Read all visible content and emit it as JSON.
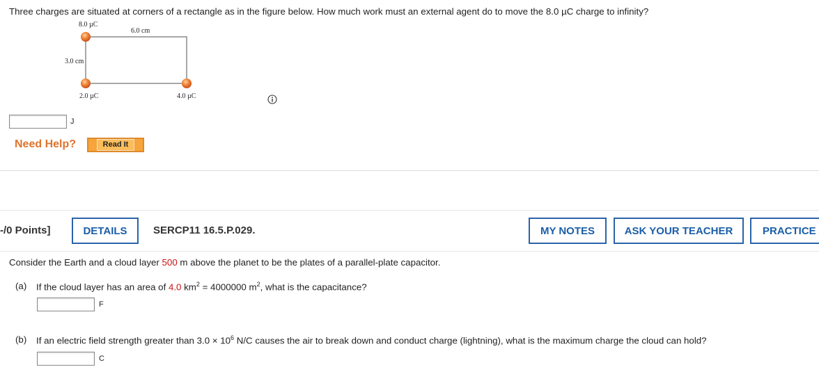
{
  "q1": {
    "text": "Three charges are situated at corners of a rectangle as in the figure below. How much work must an external agent do to move the 8.0 µC charge to infinity?",
    "figure": {
      "top_left_charge": "8.0 µC",
      "top_dimension": "6.0 cm",
      "side_dimension": "3.0 cm",
      "bottom_left_charge": "2.0 µC",
      "bottom_right_charge": "4.0 µC"
    },
    "answer_value": "",
    "unit": "J",
    "need_help": "Need Help?",
    "read_it": "Read It"
  },
  "q2": {
    "points": "-/0 Points]",
    "details": "DETAILS",
    "code": "SERCP11 16.5.P.029.",
    "my_notes": "MY NOTES",
    "ask_teacher": "ASK YOUR TEACHER",
    "practice": "PRACTICE A",
    "intro_pre": "Consider the Earth and a cloud layer ",
    "intro_val": "500",
    "intro_post": " m above the planet to be the plates of a parallel-plate capacitor.",
    "a_label": "(a)",
    "a_pre": "If the cloud layer has an area of ",
    "a_val": "4.0",
    "a_mid": " km",
    "a_eq": " = 4000000 m",
    "a_post": ", what is the capacitance?",
    "a_sup1": "2",
    "a_sup2": "2",
    "a_unit": "F",
    "a_answer": "",
    "b_label": "(b)",
    "b_pre": "If an electric field strength greater than 3.0 × 10",
    "b_sup": "6",
    "b_post": " N/C causes the air to break down and conduct charge (lightning), what is the maximum charge the cloud can hold?",
    "b_unit": "C",
    "b_answer": ""
  },
  "colors": {
    "accent_blue": "#1b5ea8",
    "help_orange": "#e0732b",
    "value_red": "#cc1010",
    "charge_orange": "#f07a2a"
  }
}
